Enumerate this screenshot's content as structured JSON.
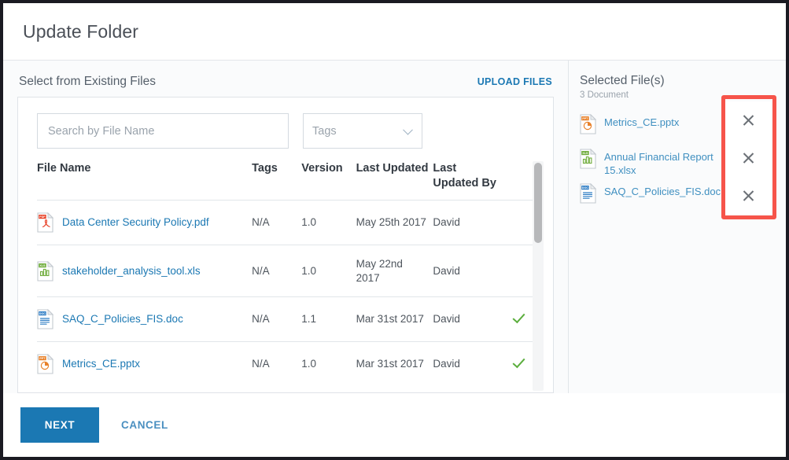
{
  "dialog": {
    "title": "Update Folder"
  },
  "left": {
    "section_title": "Select from Existing Files",
    "upload_link": "UPLOAD FILES",
    "search": {
      "placeholder": "Search by File Name",
      "value": ""
    },
    "tags": {
      "label": "Tags"
    },
    "columns": [
      "File Name",
      "Tags",
      "Version",
      "Last Updated",
      "Last Updated By"
    ],
    "rows": [
      {
        "icon": "pdf-file-icon",
        "name": "Data Center Security Policy.pdf",
        "tags": "N/A",
        "version": "1.0",
        "last_updated": "May 25th 2017",
        "last_updated_by": "David",
        "selected": false
      },
      {
        "icon": "xls-file-icon",
        "name": "stakeholder_analysis_tool.xls",
        "tags": "N/A",
        "version": "1.0",
        "last_updated": "May 22nd 2017",
        "last_updated_by": "David",
        "selected": false
      },
      {
        "icon": "doc-file-icon",
        "name": "SAQ_C_Policies_FIS.doc",
        "tags": "N/A",
        "version": "1.1",
        "last_updated": "Mar 31st 2017",
        "last_updated_by": "David",
        "selected": true
      },
      {
        "icon": "pptx-file-icon",
        "name": "Metrics_CE.pptx",
        "tags": "N/A",
        "version": "1.0",
        "last_updated": "Mar 31st 2017",
        "last_updated_by": "David",
        "selected": true
      }
    ]
  },
  "right": {
    "title": "Selected File(s)",
    "count_label": "3 Document",
    "items": [
      {
        "icon": "pptx-file-icon",
        "name": "Metrics_CE.pptx"
      },
      {
        "icon": "xls-file-icon",
        "name": "Annual Financial Report 15.xlsx"
      },
      {
        "icon": "doc-file-icon",
        "name": "SAQ_C_Policies_FIS.doc"
      }
    ],
    "remove_label": "×"
  },
  "footer": {
    "next_label": "NEXT",
    "cancel_label": "CANCEL"
  },
  "colors": {
    "accent": "#1b78b3",
    "link": "#1b78b3",
    "highlight": "#f6544a",
    "check": "#5cae3e",
    "pdf": "#e8452c",
    "xls": "#6eab3a",
    "doc": "#2f7dc4",
    "ppt": "#e8822c"
  }
}
